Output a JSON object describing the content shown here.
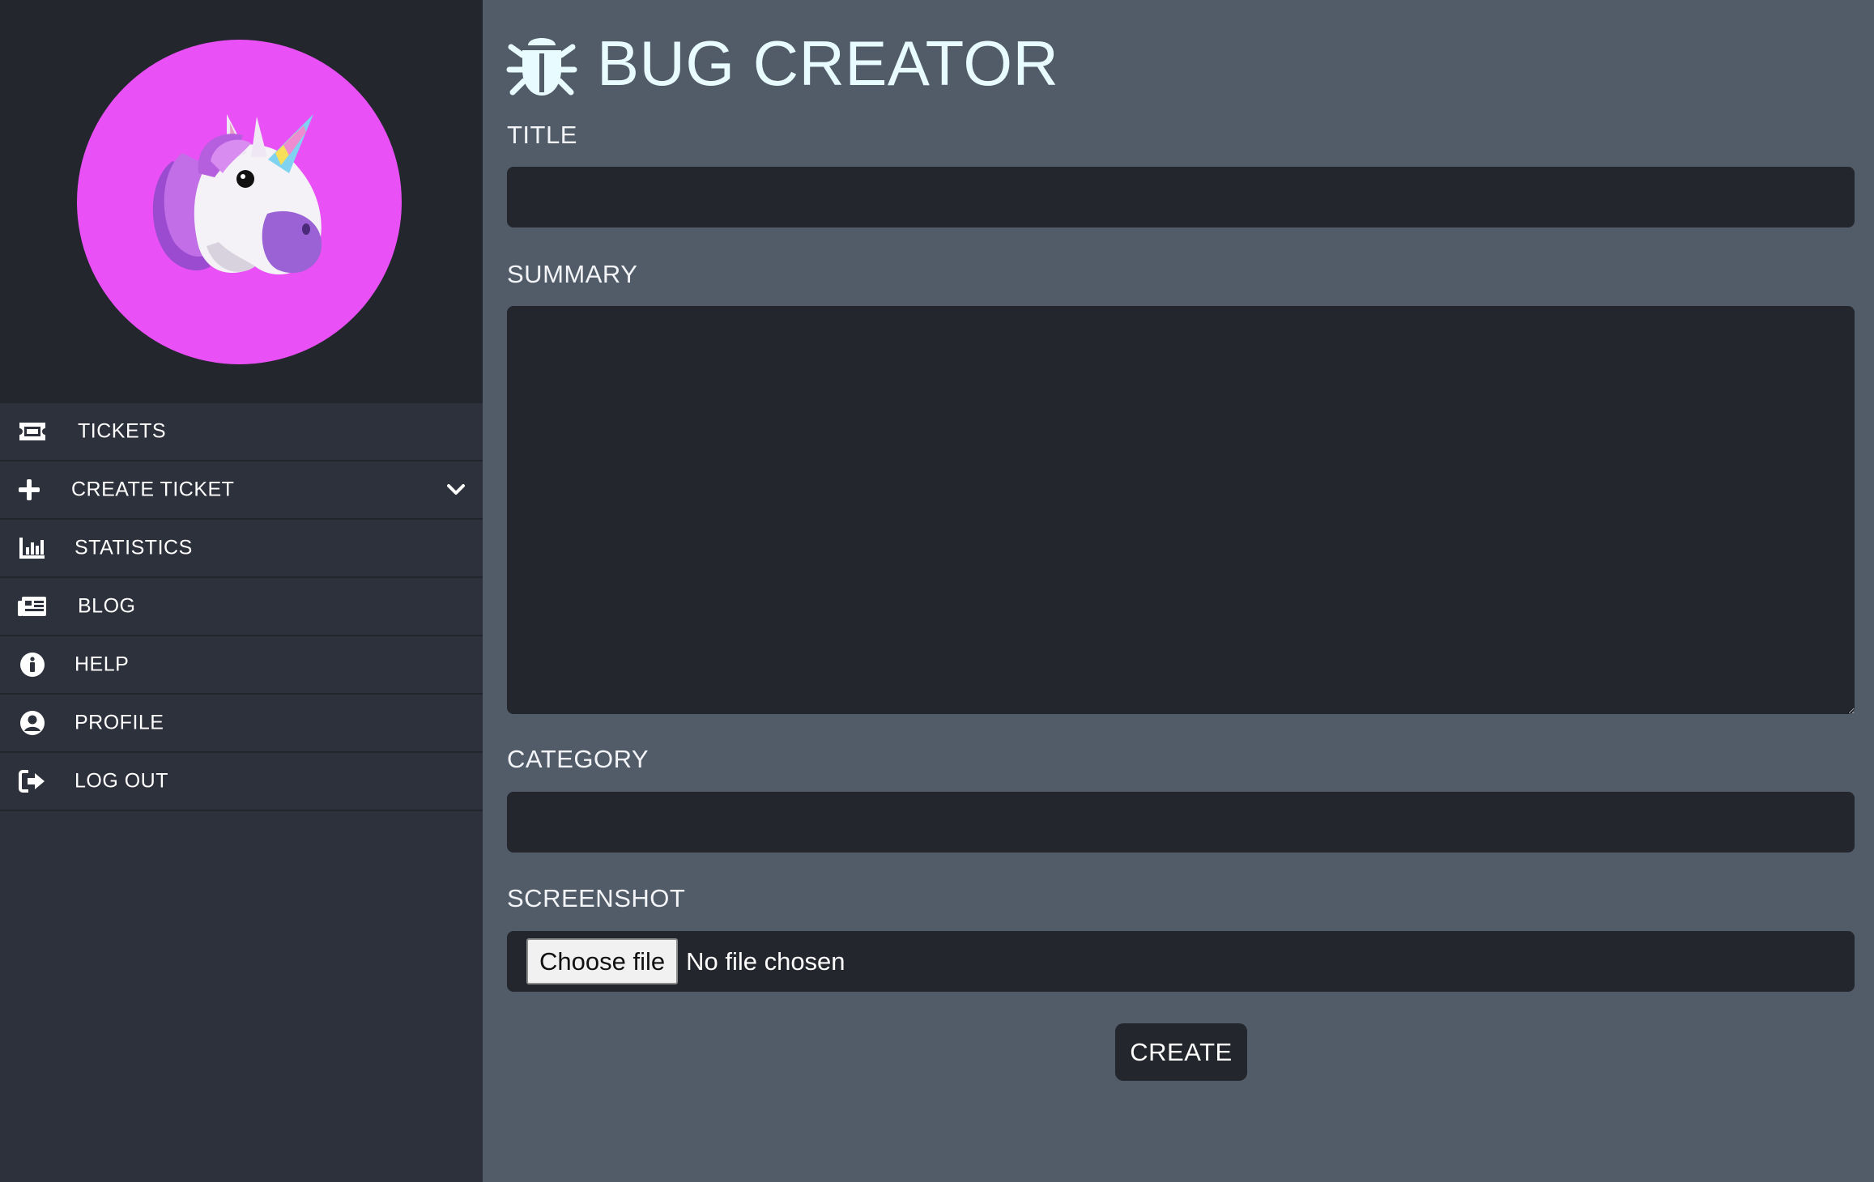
{
  "header": {
    "title": "BUG CREATOR",
    "icon": "bug-icon"
  },
  "sidebar": {
    "avatar": {
      "icon": "unicorn-icon",
      "background": "#e950f5"
    },
    "items": [
      {
        "label": "TICKETS",
        "icon": "ticket-icon"
      },
      {
        "label": "CREATE TICKET",
        "icon": "plus-icon",
        "expand_icon": "chevron-down-icon"
      },
      {
        "label": "STATISTICS",
        "icon": "chart-bar-icon"
      },
      {
        "label": "BLOG",
        "icon": "newspaper-icon"
      },
      {
        "label": "HELP",
        "icon": "info-circle-icon"
      },
      {
        "label": "PROFILE",
        "icon": "user-circle-icon"
      },
      {
        "label": "LOG OUT",
        "icon": "sign-out-icon"
      }
    ]
  },
  "form": {
    "title_label": "TITLE",
    "title_value": "",
    "summary_label": "SUMMARY",
    "summary_value": "",
    "category_label": "CATEGORY",
    "category_value": "",
    "screenshot_label": "SCREENSHOT",
    "choose_file_label": "Choose file",
    "file_status": "No file chosen",
    "create_label": "CREATE"
  },
  "colors": {
    "sidebar_bg": "#2d313b",
    "main_bg": "#525c69",
    "field_bg": "#24262e",
    "title_color": "#e8fbff"
  }
}
